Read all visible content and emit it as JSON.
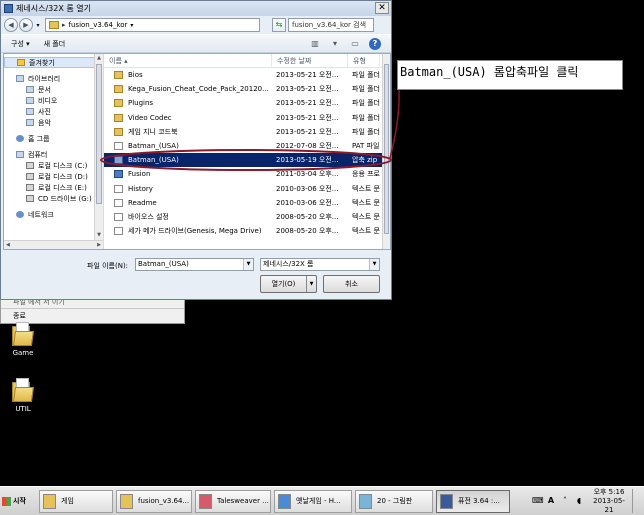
{
  "dialog": {
    "title": "제네시스/32X 롬 열기",
    "address": {
      "folder": "fusion_v3.64_kor"
    },
    "search_placeholder": "fusion_v3.64_kor 검색",
    "toolbar": {
      "organize": "구성 ▾",
      "new_folder": "새 폴더"
    },
    "nav": {
      "favorites": "즐겨찾기",
      "libraries": "라이브러리",
      "lib_items": [
        "문서",
        "비디오",
        "사진",
        "음악"
      ],
      "homegroup": "홈 그룹",
      "computer": "컴퓨터",
      "drives": [
        "로컬 디스크 (C:)",
        "로컬 디스크 (D:)",
        "로컬 디스크 (E:)",
        "CD 드라이브 (G:)"
      ],
      "network": "네트워크"
    },
    "columns": {
      "name": "이름",
      "date": "수정한 날짜",
      "type": "유형"
    },
    "files": [
      {
        "icon": "folder",
        "name": "Bios",
        "date": "2013-05-21 오전...",
        "type": "파일 폴더"
      },
      {
        "icon": "folder",
        "name": "Kega_Fusion_Cheat_Code_Pack_20120...",
        "date": "2013-05-21 오전...",
        "type": "파일 폴더"
      },
      {
        "icon": "folder",
        "name": "Plugins",
        "date": "2013-05-21 오전...",
        "type": "파일 폴더"
      },
      {
        "icon": "folder",
        "name": "Video Codec",
        "date": "2013-05-21 오전...",
        "type": "파일 폴더"
      },
      {
        "icon": "folder",
        "name": "게임 지니 코드북",
        "date": "2013-05-21 오전...",
        "type": "파일 폴더"
      },
      {
        "icon": "file",
        "name": "Batman_(USA)",
        "date": "2012-07-08 오전...",
        "type": "PAT 파일"
      },
      {
        "icon": "zip",
        "name": "Batman_(USA)",
        "date": "2013-05-19 오전...",
        "type": "압축 zip"
      },
      {
        "icon": "app",
        "name": "Fusion",
        "date": "2011-03-04 오후...",
        "type": "응용 프로"
      },
      {
        "icon": "file",
        "name": "History",
        "date": "2010-03-06 오전...",
        "type": "텍스트 문"
      },
      {
        "icon": "file",
        "name": "Readme",
        "date": "2010-03-06 오전...",
        "type": "텍스트 문"
      },
      {
        "icon": "file",
        "name": "바이오스 설정",
        "date": "2008-05-20 오후...",
        "type": "텍스트 문"
      },
      {
        "icon": "file",
        "name": "세가 메가 드라이브(Genesis, Mega Drive)",
        "date": "2008-05-20 오후...",
        "type": "텍스트 문"
      }
    ],
    "selected_index": 6,
    "filename_label": "파일 이름(N):",
    "filename_value": "Batman_(USA)",
    "filetype_value": "제네시스/32X 롬",
    "open_label": "열기(O)",
    "cancel_label": "취소"
  },
  "background_menu": {
    "partial_item": "파일 에서 서 이기",
    "exit_item": "종료"
  },
  "desktop_icons": [
    {
      "label": "Game"
    },
    {
      "label": "UTIL"
    }
  ],
  "annotation": {
    "text": "Batman_(USA)  롬압축파일 클릭",
    "circle_color": "#8b1a2a"
  },
  "taskbar": {
    "start": "시작",
    "tasks": [
      "게임",
      "fusion_v3.64...",
      "Talesweaver ...",
      "옛날게임 - H...",
      "20 - 그림판",
      "퓨전 3.64 :..."
    ],
    "active_task": 5,
    "clock_time": "오후 5:16",
    "clock_date": "2013-05-21"
  }
}
